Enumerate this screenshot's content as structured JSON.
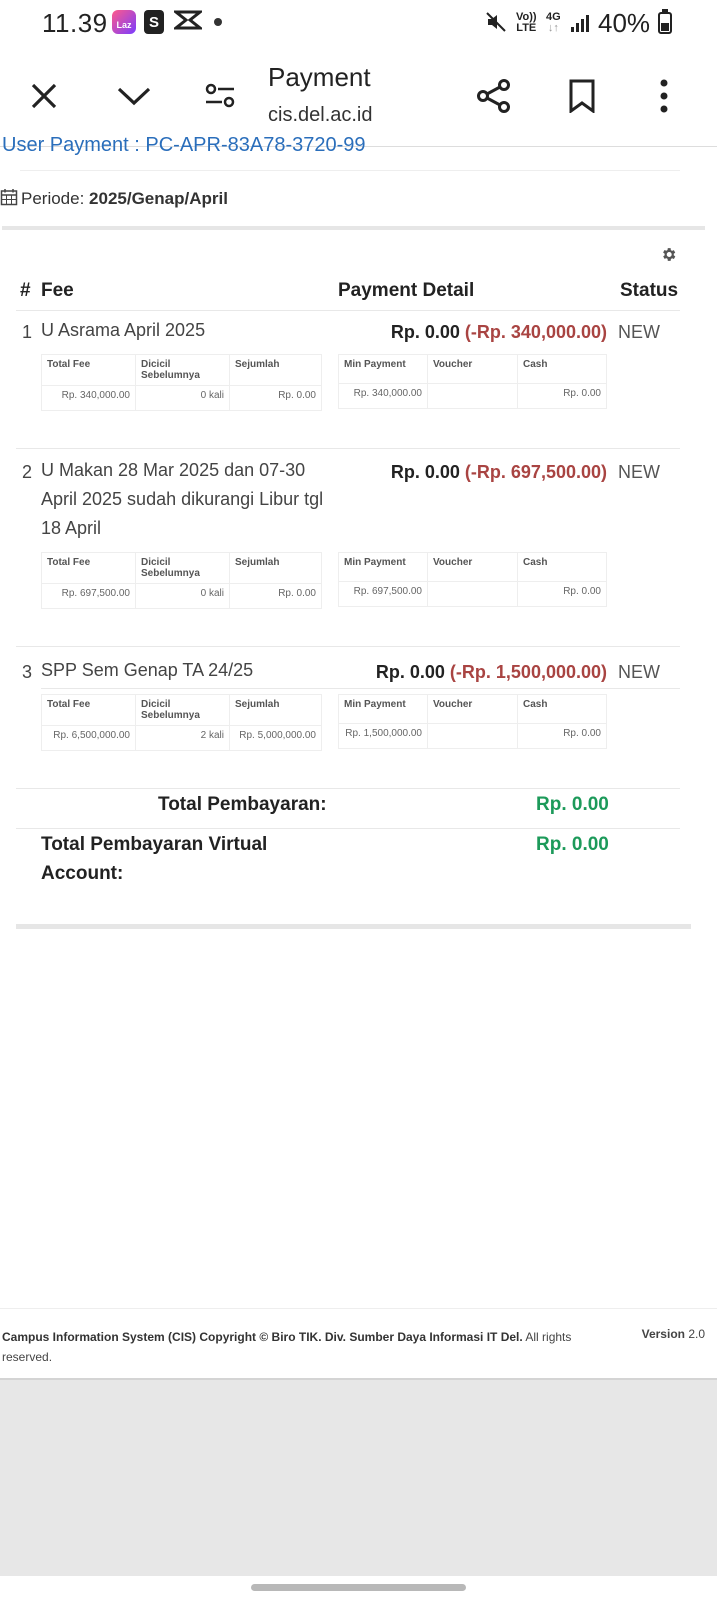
{
  "status_bar": {
    "time": "11.39",
    "lazada_label": "Laz",
    "shop_label": "S",
    "volte_top": "Vo))",
    "volte_bottom": "LTE",
    "net_top": "4G",
    "net_bottom": "↓↑",
    "battery": "40%"
  },
  "browser": {
    "title": "Payment",
    "url": "cis.del.ac.id"
  },
  "page": {
    "user_payment": "User Payment : PC-APR-83A78-3720-99",
    "periode_label": "Periode: ",
    "periode_value": "2025/Genap/April",
    "headers": {
      "num": "#",
      "fee": "Fee",
      "payment_detail": "Payment Detail",
      "status": "Status"
    },
    "fee_table_headers": [
      "Total Fee",
      "Dicicil Sebelumnya",
      "Sejumlah"
    ],
    "pay_table_headers": [
      "Min Payment",
      "Voucher",
      "Cash"
    ],
    "items": [
      {
        "num": "1",
        "name": "U Asrama April 2025",
        "amount": "Rp. 0.00",
        "amount_neg": "(-Rp. 340,000.00)",
        "status": "NEW",
        "total_fee": "Rp. 340,000.00",
        "dicicil": "0 kali",
        "sejumlah": "Rp. 0.00",
        "min_payment": "Rp. 340,000.00",
        "voucher": "",
        "cash": "Rp. 0.00"
      },
      {
        "num": "2",
        "name": "U Makan 28 Mar 2025 dan 07-30 April 2025 sudah dikurangi Libur tgl 18 April",
        "amount": "Rp. 0.00",
        "amount_neg": "(-Rp. 697,500.00)",
        "status": "NEW",
        "total_fee": "Rp. 697,500.00",
        "dicicil": "0 kali",
        "sejumlah": "Rp. 0.00",
        "min_payment": "Rp. 697,500.00",
        "voucher": "",
        "cash": "Rp. 0.00"
      },
      {
        "num": "3",
        "name": "SPP Sem Genap TA 24/25",
        "amount": "Rp. 0.00",
        "amount_neg": "(-Rp. 1,500,000.00)",
        "status": "NEW",
        "total_fee": "Rp. 6,500,000.00",
        "dicicil": "2 kali",
        "sejumlah": "Rp. 5,000,000.00",
        "min_payment": "Rp. 1,500,000.00",
        "voucher": "",
        "cash": "Rp. 0.00"
      }
    ],
    "total_label": "Total Pembayaran:",
    "total_value": "Rp. 0.00",
    "va_label": "Total Pembayaran Virtual Account:",
    "va_value": "Rp. 0.00"
  },
  "footer": {
    "copyright_bold": "Campus Information System (CIS) Copyright © Biro TIK. Div. Sumber Daya Informasi IT Del.",
    "copyright_rest": " All rights reserved.",
    "version_label": "Version",
    "version_value": " 2.0"
  },
  "colors": {
    "link": "#2a6ebb",
    "negative": "#a94442",
    "total_green": "#1d9a5a"
  },
  "icons": [
    "close-icon",
    "chevron-down-icon",
    "tune-icon",
    "share-icon",
    "bookmark-icon",
    "more-vert-icon",
    "calendar-icon",
    "gear-icon"
  ]
}
